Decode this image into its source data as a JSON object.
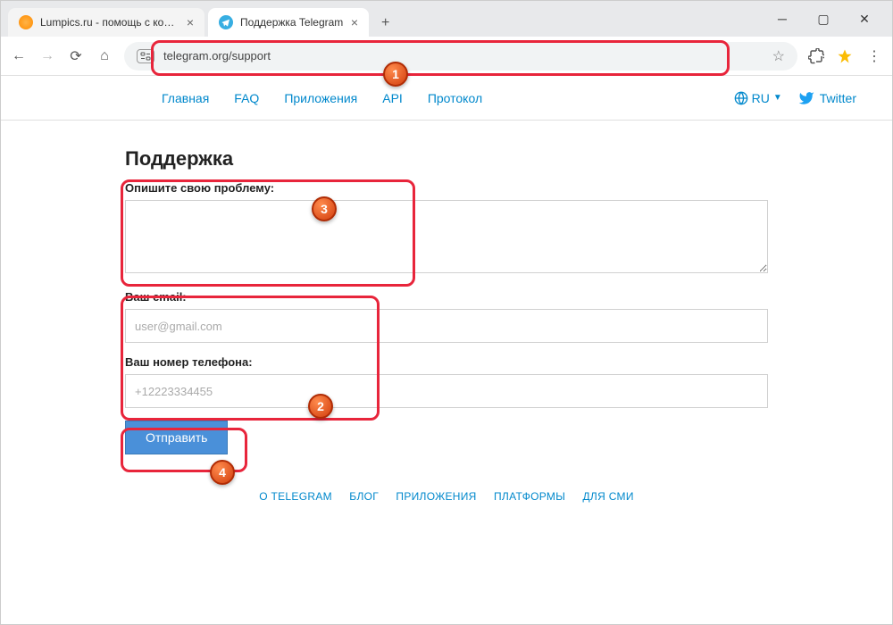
{
  "tabs": {
    "tab1_title": "Lumpics.ru - помощь с компью",
    "tab2_title": "Поддержка Telegram"
  },
  "url": "telegram.org/support",
  "nav": {
    "home": "Главная",
    "faq": "FAQ",
    "apps": "Приложения",
    "api": "API",
    "protocol": "Протокол",
    "lang": "RU",
    "twitter": "Twitter"
  },
  "page": {
    "title": "Поддержка",
    "problem_label": "Опишите свою проблему:",
    "email_label": "Ваш email:",
    "email_placeholder": "user@gmail.com",
    "phone_label": "Ваш номер телефона:",
    "phone_placeholder": "+12223334455",
    "submit": "Отправить"
  },
  "footer": {
    "about": "О TELEGRAM",
    "blog": "БЛОГ",
    "apps": "ПРИЛОЖЕНИЯ",
    "platforms": "ПЛАТФОРМЫ",
    "press": "ДЛЯ СМИ"
  },
  "markers": {
    "m1": "1",
    "m2": "2",
    "m3": "3",
    "m4": "4"
  }
}
